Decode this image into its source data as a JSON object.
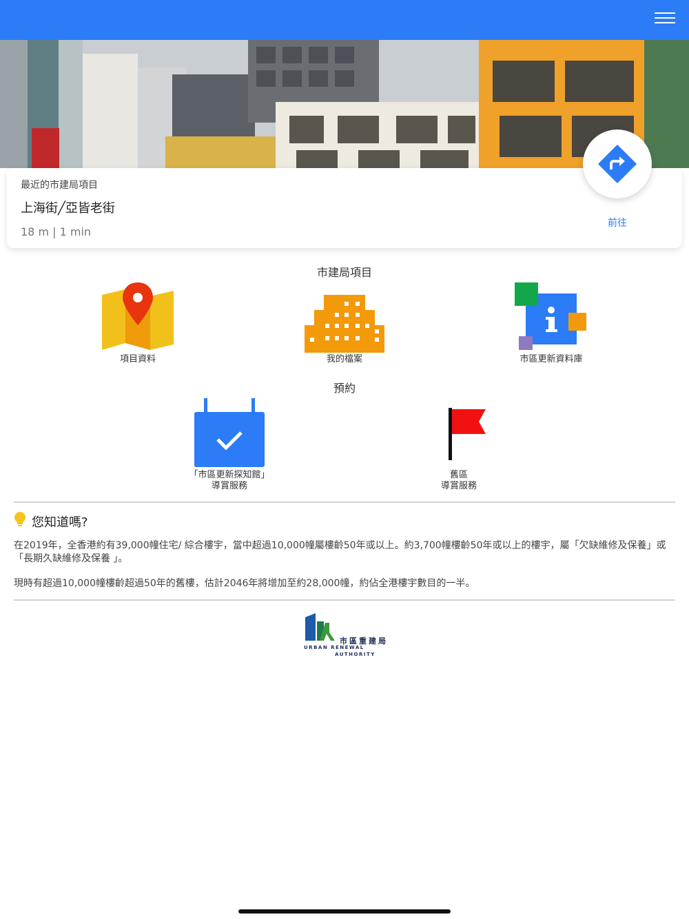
{
  "header": {
    "menu_icon": "hamburger-menu-icon",
    "background": "#2b7cf6"
  },
  "nearest_project": {
    "label": "最近的市建局項目",
    "name": "上海街╱亞皆老街",
    "distance_time": "18 m | 1 min",
    "go_label": "前往",
    "go_icon": "directions-icon"
  },
  "projects_section": {
    "title": "市建局項目",
    "items": [
      {
        "label": "項目資料",
        "icon": "map-pin-icon"
      },
      {
        "label": "我的檔案",
        "icon": "building-icon"
      },
      {
        "label": "市區更新資料庫",
        "icon": "info-icon"
      }
    ]
  },
  "booking_section": {
    "title": "預約",
    "items": [
      {
        "label_line1": "「市區更新探知館」",
        "label_line2": "導賞服務",
        "icon": "calendar-check-icon"
      },
      {
        "label_line1": "舊區",
        "label_line2": "導賞服務",
        "icon": "flag-icon"
      }
    ]
  },
  "did_you_know": {
    "title": "您知道嗎?",
    "icon": "lightbulb-icon",
    "paragraphs": [
      "在2019年，全香港約有39,000幢住宅/ 綜合樓宇，當中超過10,000幢屬樓齡50年或以上。約3,700幢樓齡50年或以上的樓宇，屬「欠缺維修及保養」或 「長期久缺維修及保養 」。",
      "現時有超過10,000幢樓齡超過50年的舊樓，估計2046年將增加至約28,000幢，約佔全港樓宇數目的一半。"
    ]
  },
  "footer": {
    "logo_cn": "市區重建局",
    "logo_en_line1": "URBAN RENEWAL",
    "logo_en_line2": "AUTHORITY"
  }
}
